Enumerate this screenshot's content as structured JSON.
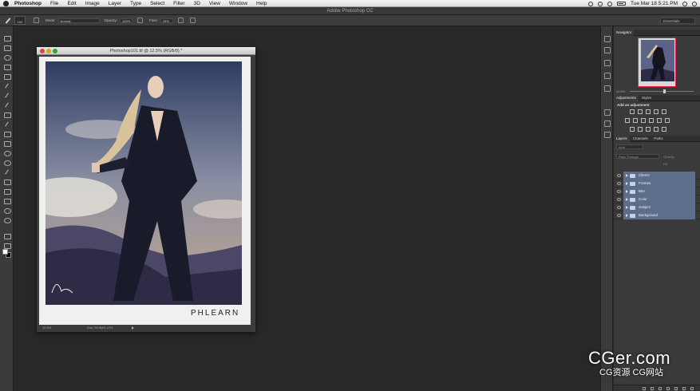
{
  "menubar": {
    "app_name": "Photoshop",
    "items": [
      "File",
      "Edit",
      "Image",
      "Layer",
      "Type",
      "Select",
      "Filter",
      "3D",
      "View",
      "Window",
      "Help"
    ],
    "clock": "Tue Mar 18  5:21 PM"
  },
  "app_title": "Adobe Photoshop CC",
  "options": {
    "brush_size": "100",
    "mode_label": "Mode:",
    "mode_value": "Normal",
    "opacity_label": "Opacity:",
    "opacity_value": "100%",
    "flow_label": "Flow:",
    "flow_value": "29%",
    "workspace": "Essentials"
  },
  "document": {
    "title": "Photoshop101.tif @ 12.5% (RGB/8) *",
    "zoom": "12.5%",
    "doc_size": "Doc: 93.9M/1.17G",
    "logo_text": "PHLEARN"
  },
  "panels": {
    "navigator_tab": "Navigator",
    "navigator_zoom": "12.5%",
    "navigator_zoom_level": 0.55,
    "adjustments_tab": "Adjustments",
    "styles_tab": "Styles",
    "add_adjustment": "Add an adjustment",
    "layers_tab": "Layers",
    "channels_tab": "Channels",
    "paths_tab": "Paths",
    "kind_filter": "Kind",
    "blend_mode": "Pass Through",
    "opacity_label": "Opacity:",
    "fill_label": "Fill:",
    "layers": [
      {
        "name": "Clients"
      },
      {
        "name": "Frames"
      },
      {
        "name": "Blur"
      },
      {
        "name": "Color"
      },
      {
        "name": "Subject"
      },
      {
        "name": "Background"
      }
    ]
  },
  "watermark": {
    "main": "CGer.com",
    "sub": "CG资源 CG网站"
  }
}
